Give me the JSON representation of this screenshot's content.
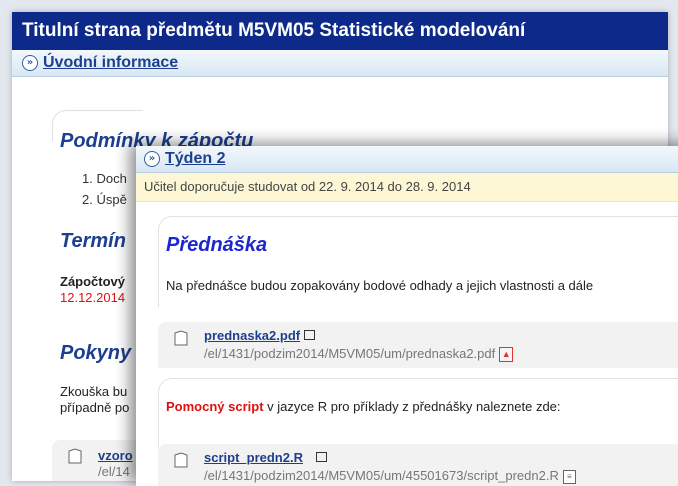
{
  "outer": {
    "title": "Titulní strana předmětu M5VM05 Statistické modelování",
    "section_link": "Úvodní informace",
    "heading1": "Podmínky k zápočtu",
    "list": [
      "1.  Doch",
      "2.  Úspě"
    ],
    "heading2": "Termín",
    "zapoctovy_label": "Zápočtový",
    "zapoctovy_date": "12.12.2014",
    "heading3": "Pokyny",
    "p1": "Zkouška bu",
    "p2": "případně po",
    "file_link": "vzoro",
    "file_path": "/el/14"
  },
  "front": {
    "section_link": "Týden 2",
    "note": "Učitel doporučuje studovat od 22. 9. 2014 do 28. 9. 2014",
    "heading": "Přednáška",
    "paragraph": "Na přednášce budou zopakovány bodové odhady a jejich vlastnosti a dále",
    "file1": {
      "name": "prednaska2.pdf",
      "path": "/el/1431/podzim2014/M5VM05/um/prednaska2.pdf"
    },
    "script_red": "Pomocný script",
    "script_rest": " v jazyce R pro příklady z přednášky naleznete zde:",
    "file2": {
      "name": "script_predn2.R",
      "path": "/el/1431/podzim2014/M5VM05/um/45501673/script_predn2.R"
    }
  }
}
